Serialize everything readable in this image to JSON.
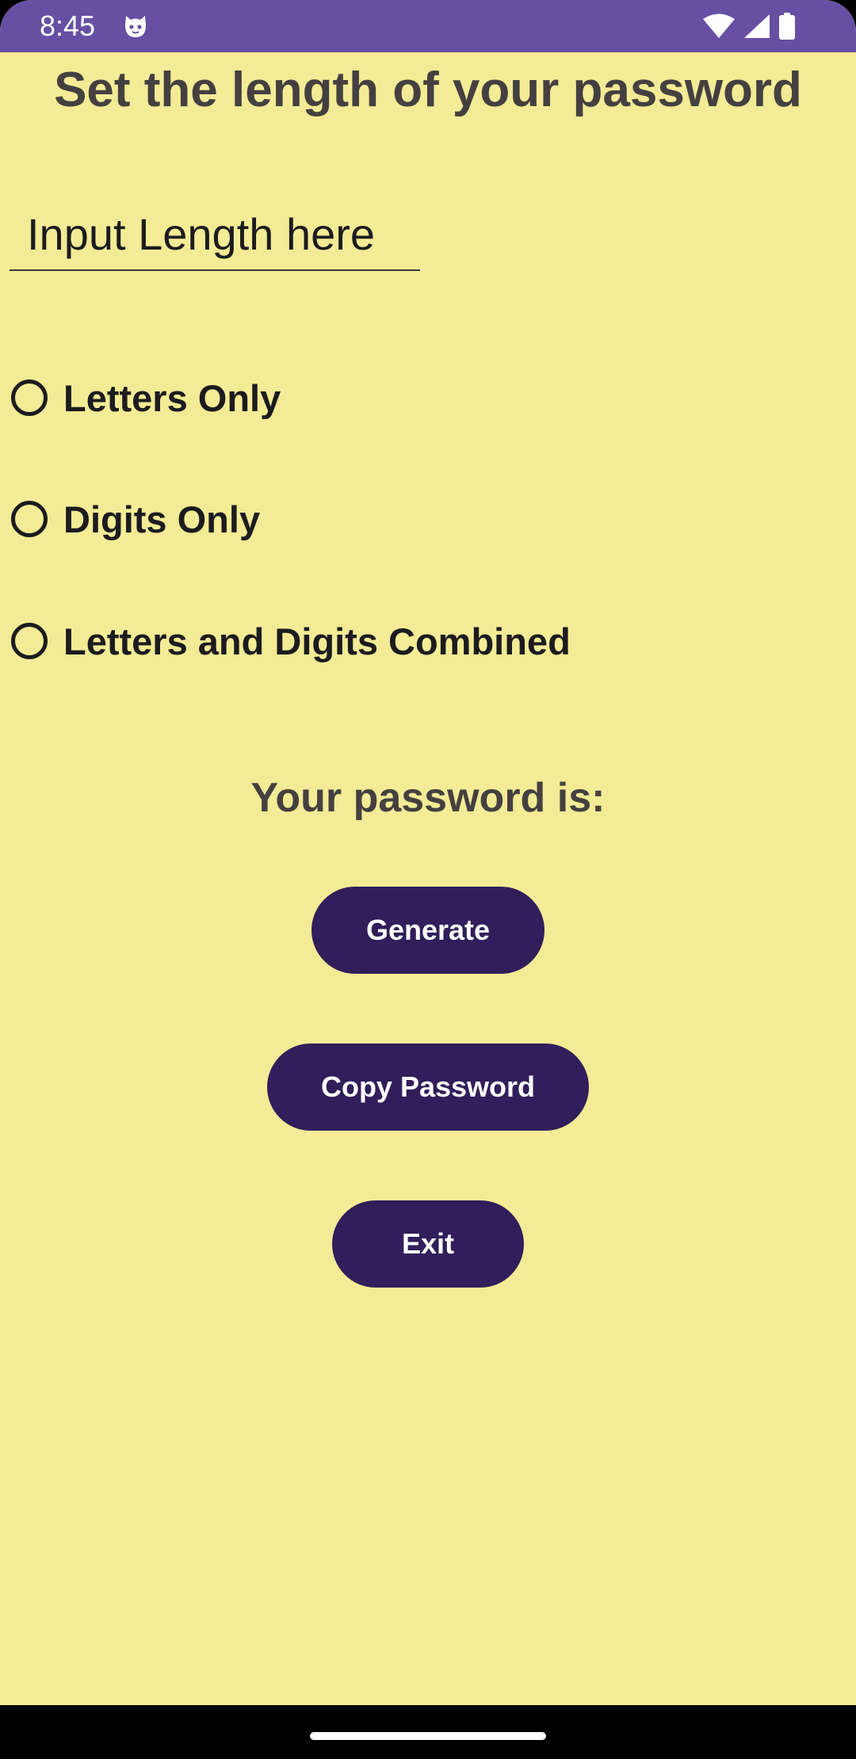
{
  "status_bar": {
    "time": "8:45",
    "app_icon": "cat-face-icon",
    "icons": [
      "wifi-icon",
      "signal-icon",
      "battery-icon"
    ],
    "background": "#6750a4"
  },
  "title": "Set the length of your password",
  "length_input": {
    "placeholder": "Input Length here",
    "value": ""
  },
  "options": [
    {
      "label": "Letters Only",
      "selected": false
    },
    {
      "label": "Digits Only",
      "selected": false
    },
    {
      "label": "Letters and Digits Combined",
      "selected": false
    }
  ],
  "result_label": "Your password is:",
  "buttons": {
    "generate": "Generate",
    "copy": "Copy Password",
    "exit": "Exit"
  },
  "colors": {
    "background": "#f3eb95",
    "button": "#311e5a",
    "title_text": "#454040"
  }
}
